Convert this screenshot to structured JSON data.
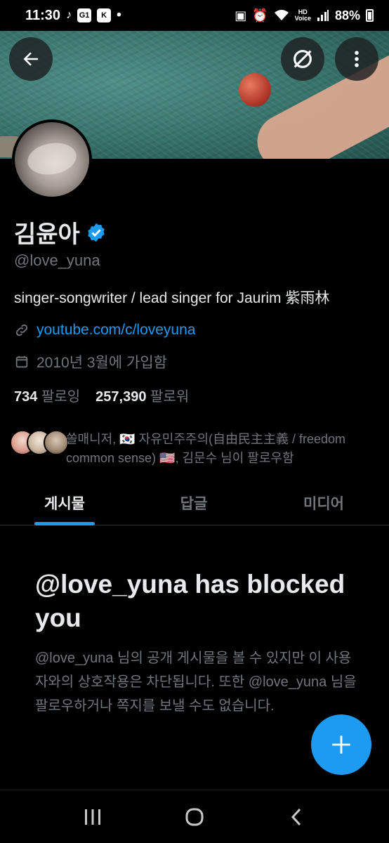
{
  "status_bar": {
    "time": "11:30",
    "notif_1": "G1",
    "notif_2": "K",
    "dot": "•",
    "hd": "HD",
    "voice": "Voice",
    "battery": "88%"
  },
  "profile": {
    "display_name": "김윤아",
    "handle": "@love_yuna",
    "bio": "singer-songwriter / lead singer for Jaurim 紫雨林",
    "link": "youtube.com/c/loveyuna",
    "joined": "2010년 3월에 가입함",
    "following_count": "734",
    "following_label": "팔로잉",
    "followers_count": "257,390",
    "followers_label": "팔로워",
    "followers_you_know": "쏠매니저, 🇰🇷 자유민주주의(自由民主主義 / freedom common sense) 🇺🇸, 김문수 님이 팔로우함"
  },
  "tabs": [
    {
      "label": "게시물",
      "active": true
    },
    {
      "label": "답글",
      "active": false
    },
    {
      "label": "미디어",
      "active": false
    }
  ],
  "blocked": {
    "title": "@love_yuna has blocked you",
    "description": "@love_yuna 님의 공개 게시물을 볼 수 있지만 이 사용자와의 상호작용은 차단됩니다. 또한 @love_yuna 님을 팔로우하거나 쪽지를 보낼 수도 없습니다."
  },
  "colors": {
    "accent": "#1d9bf0",
    "text_primary": "#e7e9ea",
    "text_secondary": "#71767b",
    "background": "#000000"
  },
  "icons": {
    "back": "arrow-left-icon",
    "grok_off": "grok-off-icon",
    "more": "more-vertical-icon",
    "verified": "verified-badge-icon",
    "link": "link-icon",
    "calendar": "calendar-icon",
    "compose": "plus-icon",
    "nav_recent": "recent-apps-icon",
    "nav_home": "home-icon",
    "nav_back": "nav-back-icon"
  }
}
